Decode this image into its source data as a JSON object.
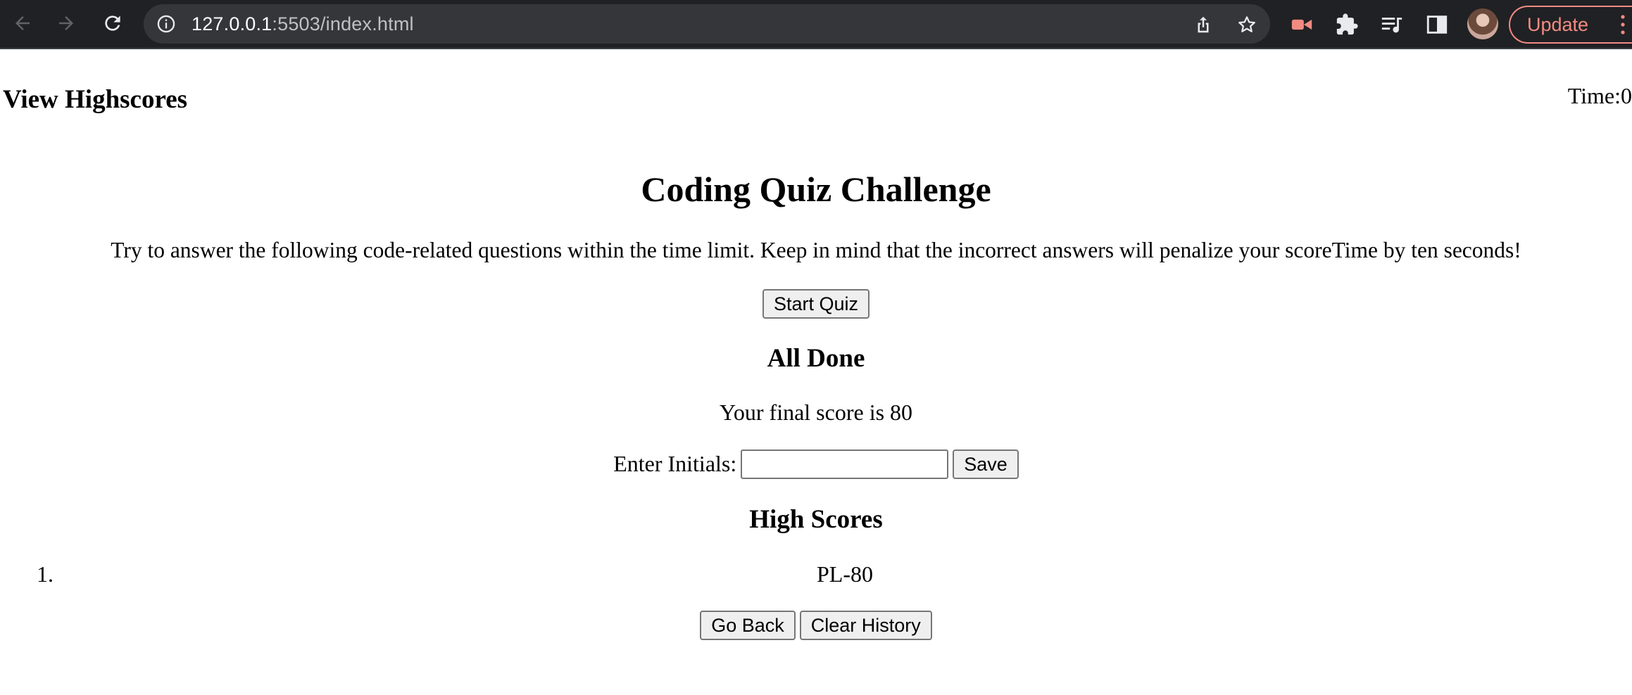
{
  "browser": {
    "url_host": "127.0.0.1",
    "url_rest": ":5503/index.html",
    "update_label": "Update"
  },
  "header": {
    "view_highscores": "View Highscores",
    "timer": "Time:0"
  },
  "quiz": {
    "title": "Coding Quiz Challenge",
    "intro": "Try to answer the following code-related questions within the time limit. Keep in mind that the incorrect answers will penalize your scoreTime by ten seconds!",
    "start_label": "Start Quiz"
  },
  "done": {
    "title": "All Done",
    "final_score": "Your final score is 80",
    "initials_label": "Enter Initials:",
    "initials_value": "",
    "save_label": "Save"
  },
  "highscores": {
    "title": "High Scores",
    "entries": [
      {
        "num": "1.",
        "text": "PL-80"
      }
    ],
    "go_back_label": "Go Back",
    "clear_label": "Clear History"
  },
  "colors": {
    "chrome_bg": "#202124",
    "omnibox_bg": "#35363a",
    "update_accent": "#f28b82"
  }
}
